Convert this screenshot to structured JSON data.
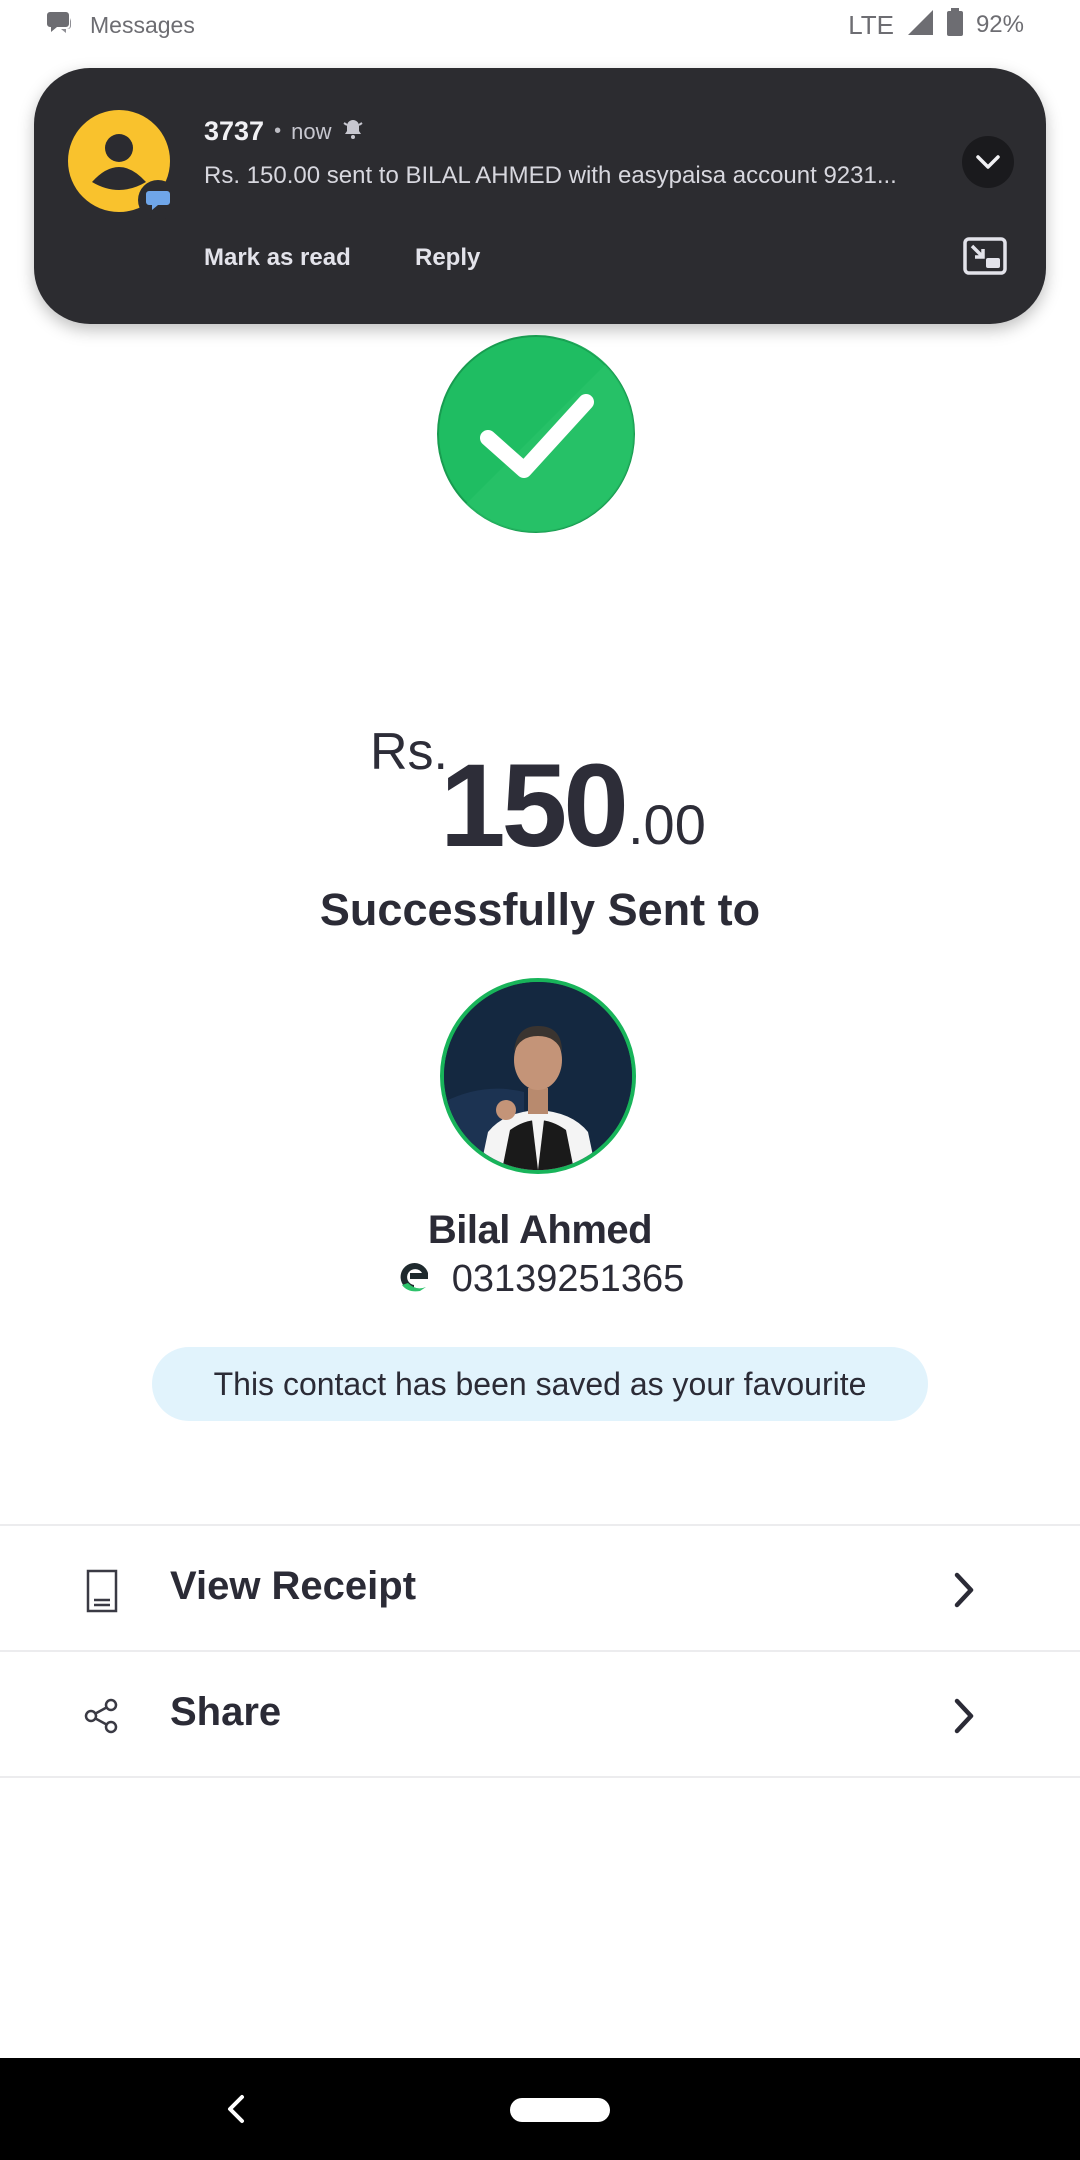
{
  "status_bar": {
    "app_name": "Messages",
    "network": "LTE",
    "battery": "92%",
    "icons": [
      "messages-icon",
      "signal-icon",
      "battery-icon"
    ]
  },
  "notification": {
    "sender": "3737",
    "separator": "•",
    "time": "now",
    "text": "Rs. 150.00 sent to BILAL AHMED with easypaisa account 9231...",
    "actions": [
      "Mark as read",
      "Reply"
    ],
    "icons": [
      "contact-avatar-icon",
      "chat-badge-icon",
      "bell-icon",
      "expand-chevron-icon",
      "picture-in-picture-icon"
    ]
  },
  "transaction": {
    "currency": "Rs.",
    "amount_whole": "150",
    "amount_decimal": ".00",
    "status_text": "Successfully Sent to",
    "status_icon": "success-check-icon"
  },
  "recipient": {
    "name": "Bilal Ahmed",
    "number": "03139251365",
    "wallet_icon": "easypaisa-logo-icon"
  },
  "favourite_message": "This contact has been saved as your favourite",
  "menu": [
    {
      "label": "View Receipt",
      "icon": "receipt-icon"
    },
    {
      "label": "Share",
      "icon": "share-icon"
    }
  ],
  "colors": {
    "success_green": "#1fbd62",
    "banner_bg": "#e1f3fc",
    "text_dark": "#2b2b36",
    "notification_bg": "#2c2c30",
    "avatar_yellow": "#f9c22d"
  }
}
